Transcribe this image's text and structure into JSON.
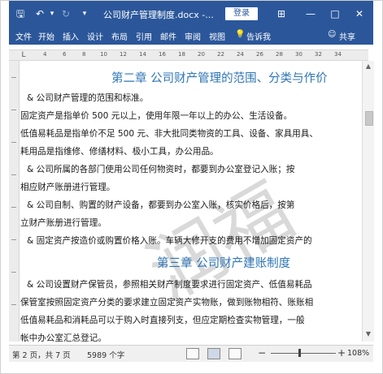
{
  "titlebar": {
    "save_icon": "save-icon",
    "undo_icon": "undo-icon",
    "redo_icon": "redo-icon",
    "customize_icon": "customize-icon",
    "title": "公司财产管理制度.docx -...",
    "login_label": "登录",
    "ribbon_options_icon": "ribbon-display-icon",
    "minimize_icon": "minimize-icon",
    "maximize_icon": "maximize-icon",
    "close_icon": "close-icon"
  },
  "ribbon": {
    "tabs": [
      "文件",
      "开始",
      "插入",
      "设计",
      "布局",
      "引用",
      "邮件",
      "审阅",
      "视图"
    ],
    "tell_me": "告诉我",
    "share": "共享"
  },
  "ruler": {
    "corner": "L",
    "ticks": [
      "4",
      "6",
      "8",
      "10",
      "12",
      "14",
      "16",
      "18",
      "20",
      "22",
      "24",
      "26",
      "28",
      "30",
      "32",
      "34"
    ]
  },
  "document": {
    "watermark": "润福",
    "heading2": "第二章   公司财产管理的范围、分类与作价",
    "paragraphs": [
      "&   公司财产管理的范围和标准。",
      "固定资产是指单价 500 元以上，使用年限一年以上的办公、生活设备。",
      "低值易耗品是指单价不足 500 元、非大批同类物资的工具、设备、家具用具、",
      "耗用品是指维修、修缮材料、极小工具，办公用品。",
      "&   公司所属的各部门使用公司任何物资时，都要到办公室登记入账；按",
      "相应财产账册进行管理。",
      "&   公司自制、购置的财产设备，都要到办公室入账，核实价格后，按第",
      "立财产账册进行管理。",
      "&   固定资产按造价或购置价格入账。车辆大修开支的费用不增加固定资产的"
    ],
    "heading3": "第三章   公司财产建账制度",
    "paragraphs2": [
      "&   公司设置财产保管员，参照相关财产制度要求进行固定资产、低值易耗品",
      "保管室按照固定资产分类的要求建立固定资产实物账，做到账物相符、账账相",
      "低值易耗品和消耗品可以于购入时直接列支，但应定期检查实物管理，一般",
      "帐中办公室汇总登记。"
    ]
  },
  "statusbar": {
    "page_info": "第 2 页，共 7 页",
    "word_count": "5989 个字",
    "zoom_level": "108%",
    "zoom_out": "−",
    "zoom_in": "+"
  }
}
